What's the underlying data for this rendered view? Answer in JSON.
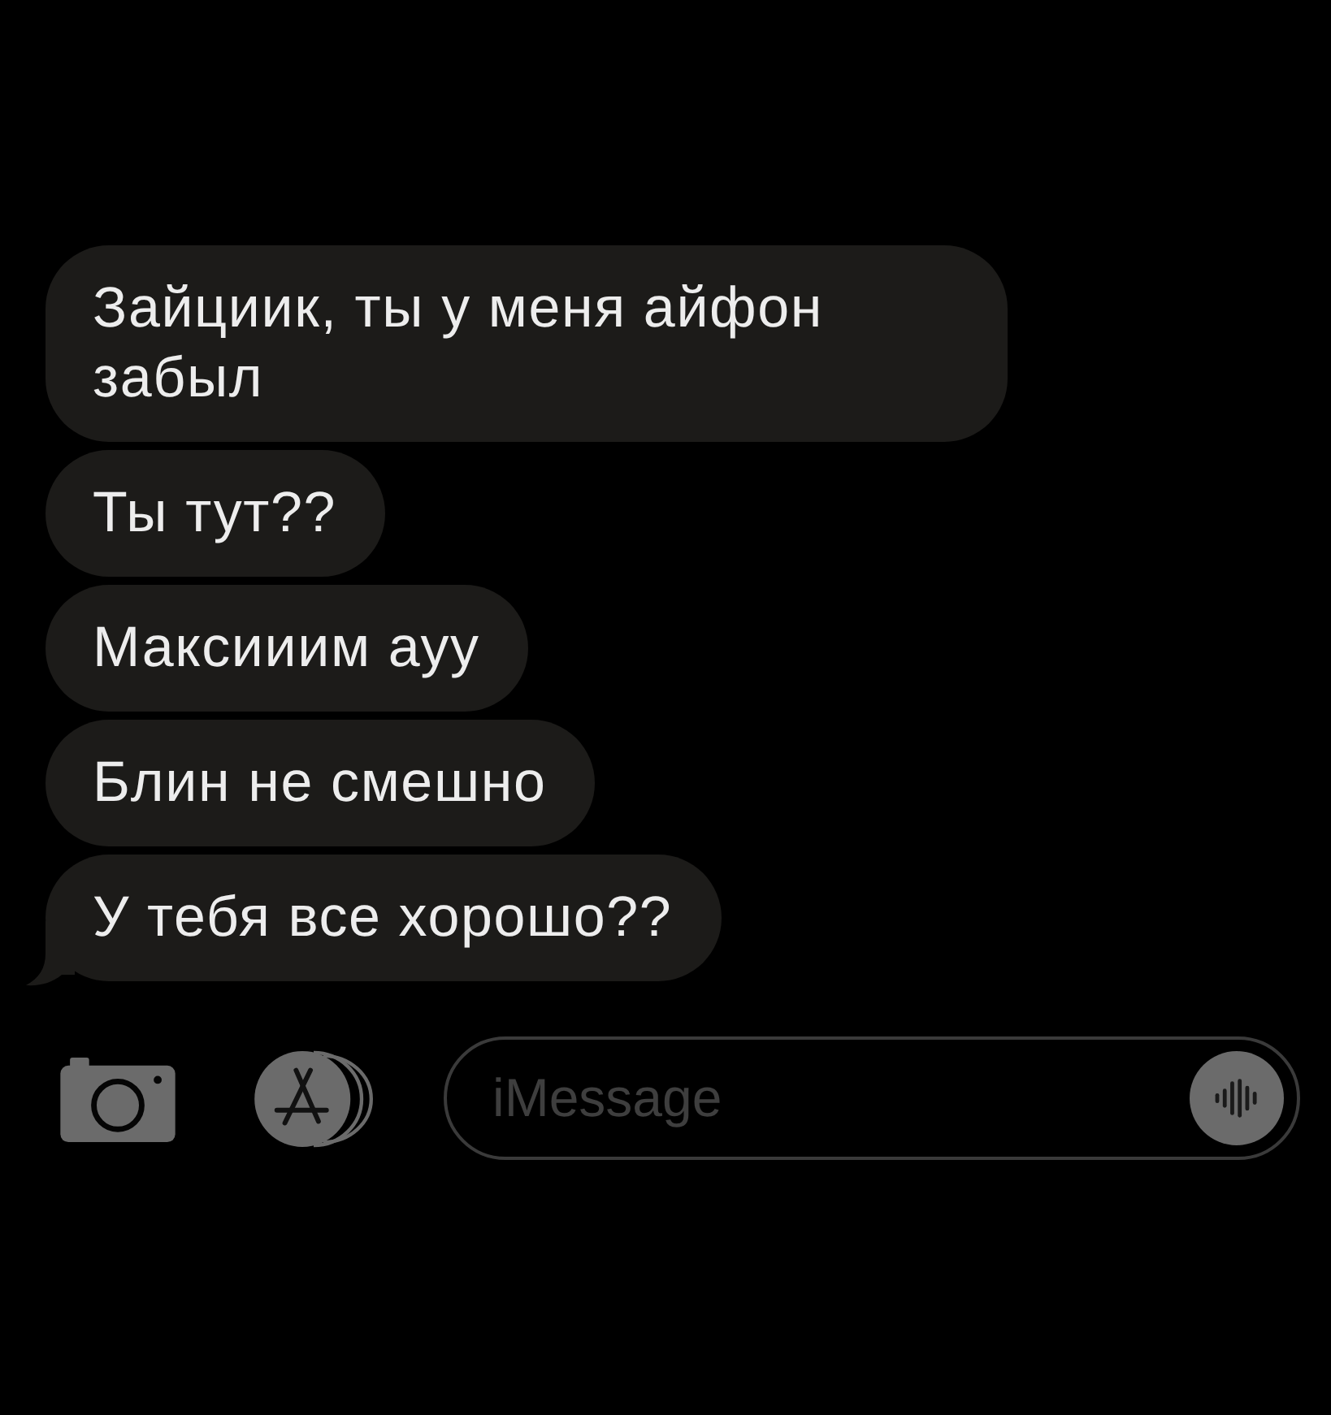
{
  "messages": [
    {
      "text": "Зайциик, ты у меня айфон забыл",
      "tail": false
    },
    {
      "text": "Ты тут??",
      "tail": false
    },
    {
      "text": "Максииим ауу",
      "tail": false
    },
    {
      "text": "Блин не смешно",
      "tail": false
    },
    {
      "text": "У тебя все хорошо??",
      "tail": true
    }
  ],
  "compose": {
    "placeholder": "iMessage"
  }
}
